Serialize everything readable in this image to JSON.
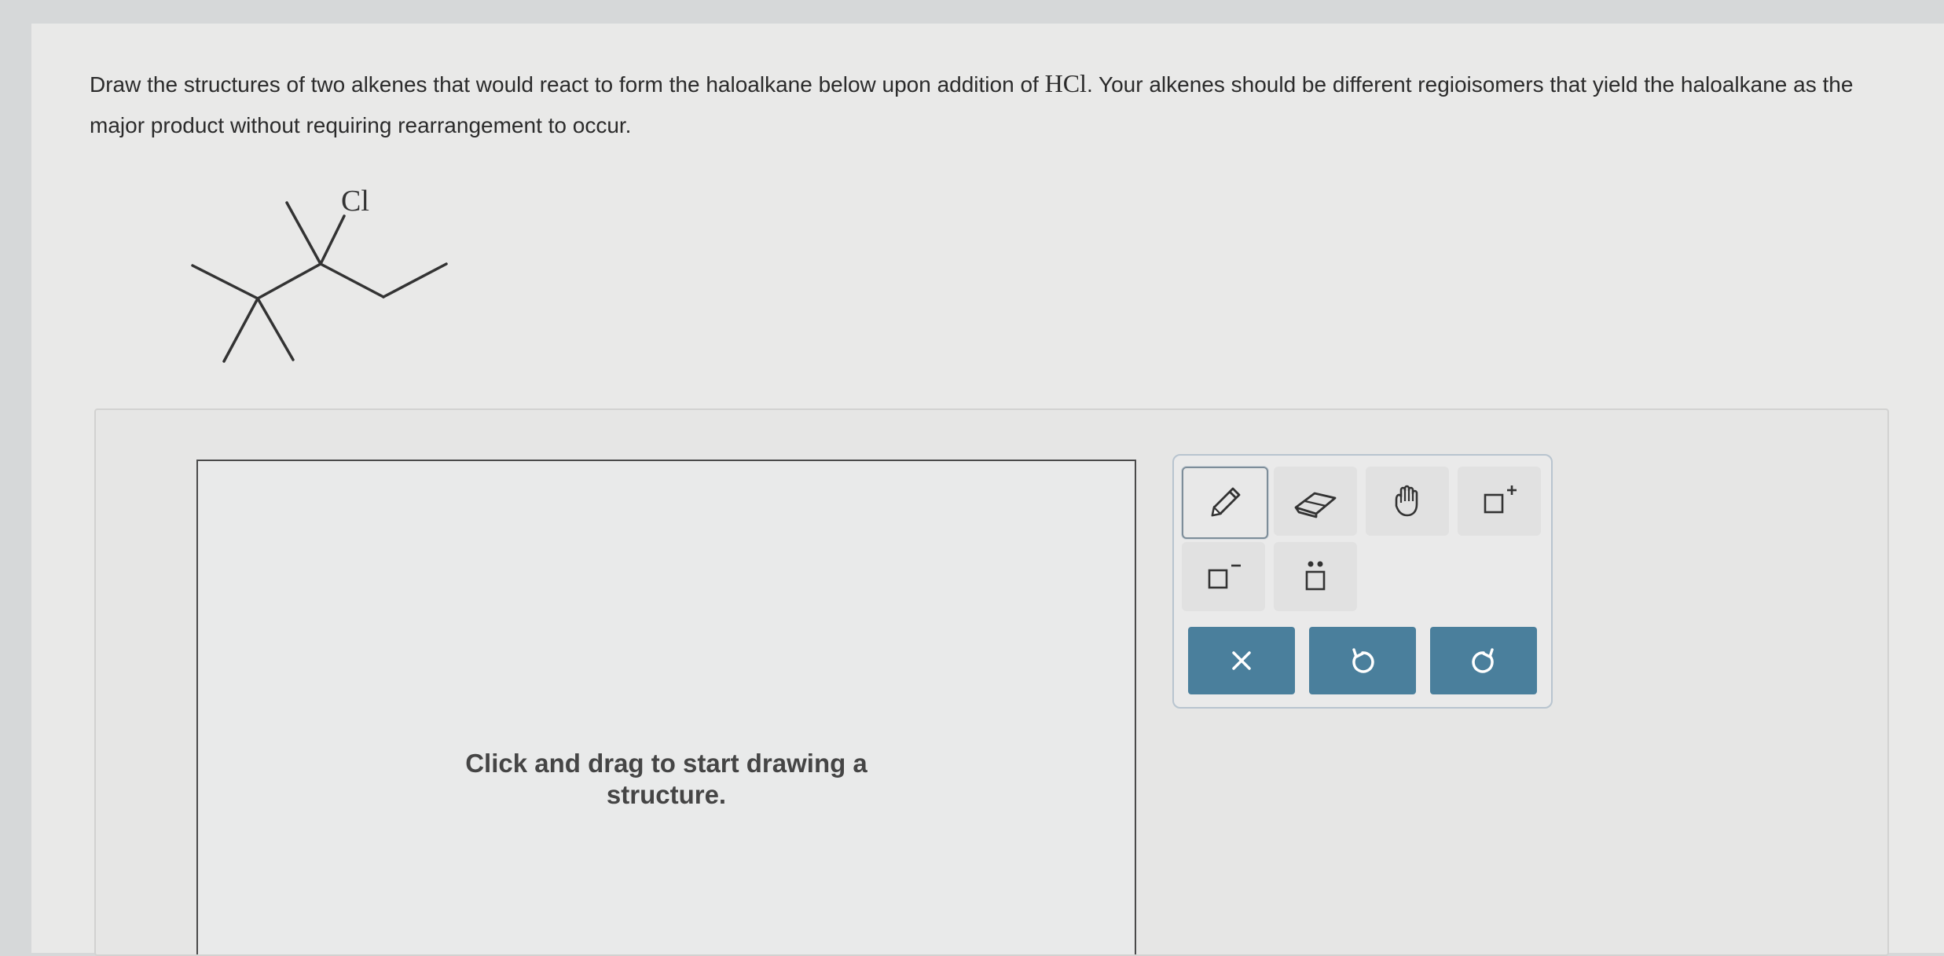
{
  "question": {
    "text_before": "Draw the structures of two alkenes that would react to form the haloalkane below upon addition of ",
    "reagent": "HCl",
    "text_after": ". Your alkenes should be different regioisomers that yield the haloalkane as the major product without requiring rearrangement to occur."
  },
  "molecule": {
    "atom_label": "Cl"
  },
  "canvas": {
    "hint_line1": "Click and drag to start drawing a",
    "hint_line2": "structure."
  },
  "toolbar": {
    "tools": [
      {
        "name": "pencil-tool",
        "icon": "pencil-icon",
        "selected": true
      },
      {
        "name": "eraser-tool",
        "icon": "eraser-icon",
        "selected": false
      },
      {
        "name": "move-tool",
        "icon": "hand-icon",
        "selected": false
      },
      {
        "name": "positive-charge-tool",
        "icon": "positive-charge-icon",
        "selected": false
      },
      {
        "name": "negative-charge-tool",
        "icon": "negative-charge-icon",
        "selected": false
      },
      {
        "name": "lone-pair-tool",
        "icon": "lone-pair-icon",
        "selected": false
      }
    ],
    "actions": [
      {
        "name": "clear-button",
        "icon": "close-icon"
      },
      {
        "name": "undo-button",
        "icon": "undo-icon"
      },
      {
        "name": "redo-button",
        "icon": "redo-icon"
      }
    ]
  },
  "colors": {
    "action_button": "#4a7f9c",
    "page_background": "#e9e9e8"
  }
}
